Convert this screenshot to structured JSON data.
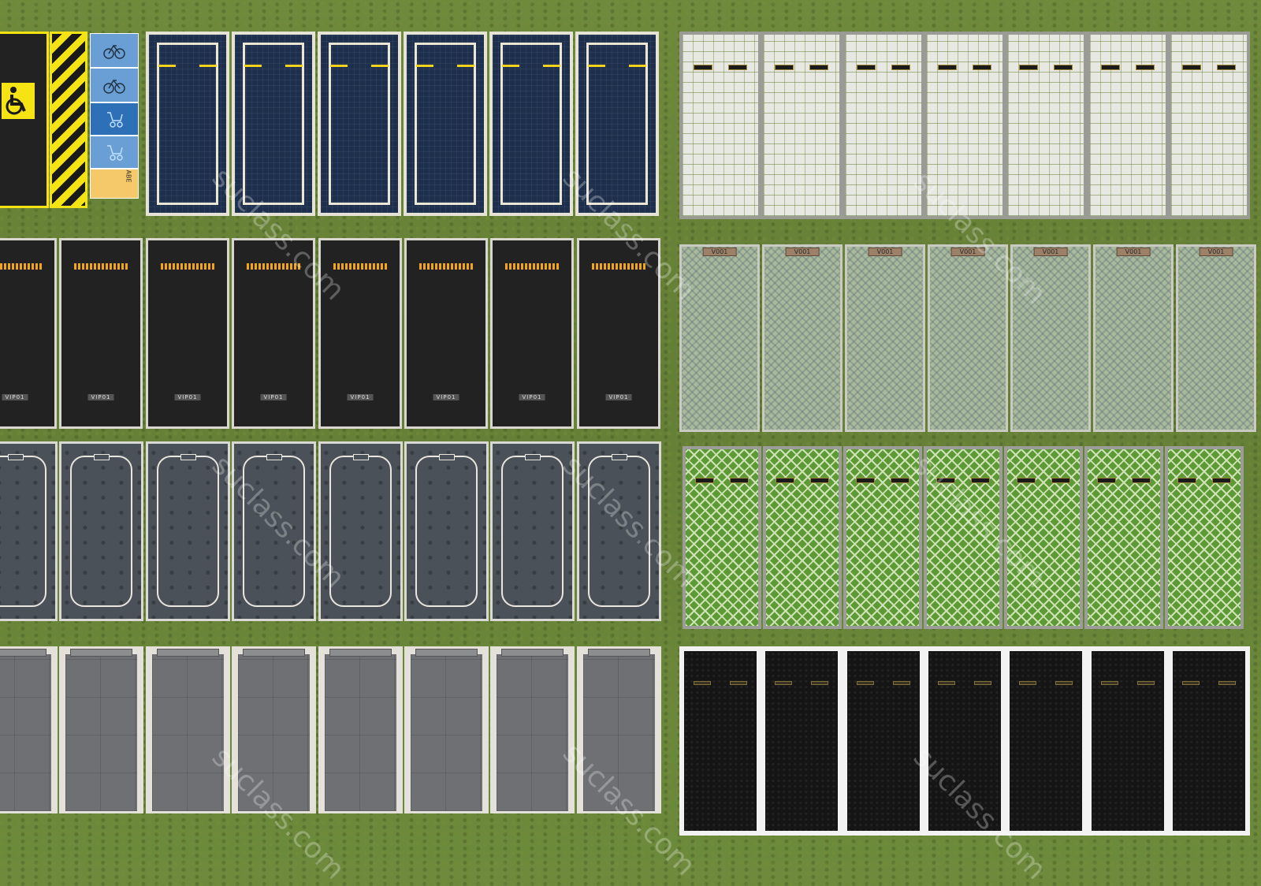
{
  "scene": {
    "background": "grass",
    "watermark_text": "suclass.com",
    "colors": {
      "grass": "#6f8a3c",
      "blue_stall": "#1d2f4c",
      "yellow_line": "#f2d21b",
      "orange_stripe": "#f2a51a",
      "accessible_yellow": "#f5e313",
      "lattice_green": "#5d9a36"
    }
  },
  "accessible_block": {
    "symbol": "wheelchair-icon",
    "side_cells": [
      {
        "icon": "bicycle-icon",
        "color": "#6a9fd6"
      },
      {
        "icon": "bicycle-icon",
        "color": "#6a9fd6"
      },
      {
        "icon": "stroller-icon",
        "color": "#2d70b8"
      },
      {
        "icon": "stroller-icon",
        "color": "#6a9fd6"
      },
      {
        "label": "ABE",
        "color": "#f5c86a"
      }
    ]
  },
  "rows": [
    {
      "style": "blue-marked",
      "count": 6,
      "side": "left"
    },
    {
      "style": "black-asphalt",
      "count": 8,
      "side": "left",
      "bay_label": "VIP01"
    },
    {
      "style": "slate-outline",
      "count": 8,
      "side": "left"
    },
    {
      "style": "grey-tile",
      "count": 8,
      "side": "left"
    },
    {
      "style": "white-paver",
      "count": 7,
      "side": "right"
    },
    {
      "style": "grass-grid",
      "count": 7,
      "side": "right",
      "plate_label": "V001"
    },
    {
      "style": "green-lattice",
      "count": 7,
      "side": "right"
    },
    {
      "style": "black-white-border",
      "count": 7,
      "side": "right"
    }
  ]
}
